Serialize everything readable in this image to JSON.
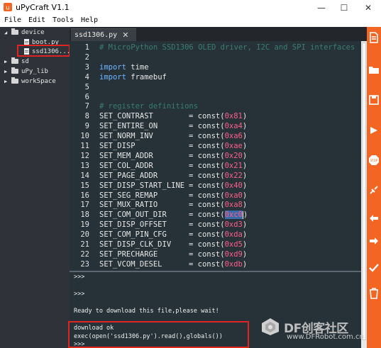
{
  "window": {
    "title": "uPyCraft V1.1",
    "minimize": "—",
    "maximize": "☐",
    "close": "✕"
  },
  "menu": [
    "File",
    "Edit",
    "Tools",
    "Help"
  ],
  "tree": {
    "device": "device",
    "boot": "boot.py",
    "ssd": "ssd1306....",
    "sd": "sd",
    "upy_lib": "uPy_lib",
    "workspace": "workSpace"
  },
  "tab": {
    "label": "ssd1306.py",
    "close": "✕"
  },
  "editor": {
    "lines": [
      {
        "n": "1",
        "t": "# MicroPython SSD1306 OLED driver, I2C and SPI interfaces"
      },
      {
        "n": "2",
        "t": ""
      },
      {
        "n": "3",
        "kw": "import",
        "rest": " time"
      },
      {
        "n": "4",
        "kw": "import",
        "rest": " framebuf"
      },
      {
        "n": "5",
        "t": ""
      },
      {
        "n": "6",
        "t": ""
      },
      {
        "n": "7",
        "t": "# register definitions"
      },
      {
        "n": "8",
        "name": "SET_CONTRAST",
        "val": "0x81"
      },
      {
        "n": "9",
        "name": "SET_ENTIRE_ON",
        "val": "0xa4"
      },
      {
        "n": "10",
        "name": "SET_NORM_INV",
        "val": "0xa6"
      },
      {
        "n": "11",
        "name": "SET_DISP",
        "val": "0xae"
      },
      {
        "n": "12",
        "name": "SET_MEM_ADDR",
        "val": "0x20"
      },
      {
        "n": "13",
        "name": "SET_COL_ADDR",
        "val": "0x21"
      },
      {
        "n": "14",
        "name": "SET_PAGE_ADDR",
        "val": "0x22"
      },
      {
        "n": "15",
        "name": "SET_DISP_START_LINE",
        "val": "0x40"
      },
      {
        "n": "16",
        "name": "SET_SEG_REMAP",
        "val": "0xa0"
      },
      {
        "n": "17",
        "name": "SET_MUX_RATIO",
        "val": "0xa8"
      },
      {
        "n": "18",
        "name": "SET_COM_OUT_DIR",
        "val": "0xc0",
        "selected": true
      },
      {
        "n": "19",
        "name": "SET_DISP_OFFSET",
        "val": "0xd3"
      },
      {
        "n": "20",
        "name": "SET_COM_PIN_CFG",
        "val": "0xda"
      },
      {
        "n": "21",
        "name": "SET_DISP_CLK_DIV",
        "val": "0xd5"
      },
      {
        "n": "22",
        "name": "SET_PRECHARGE",
        "val": "0xd9"
      },
      {
        "n": "23",
        "name": "SET_VCOM_DESEL",
        "val": "0xdb"
      }
    ],
    "assign": "= const("
  },
  "console": {
    "lines": [
      ">>>",
      "",
      ">>>",
      "",
      "Ready to download this file,please wait!",
      "",
      "download ok",
      "exec(open('ssd1306.py').read(),globals())",
      ">>>"
    ]
  },
  "watermark": {
    "text": "DF创客社区",
    "url": "www.DFRobot.com.cn"
  },
  "toolbar_icons": [
    "new-file-icon",
    "open-file-icon",
    "save-file-icon",
    "download-run-icon",
    "stop-icon",
    "connect-icon",
    "undo-icon",
    "redo-icon",
    "syntax-check-icon",
    "clear-icon"
  ],
  "colors": {
    "toolbar": "#f26522",
    "editor_bg": "#263238",
    "tree_bg": "#2f3339",
    "highlight_box": "#e02424"
  }
}
